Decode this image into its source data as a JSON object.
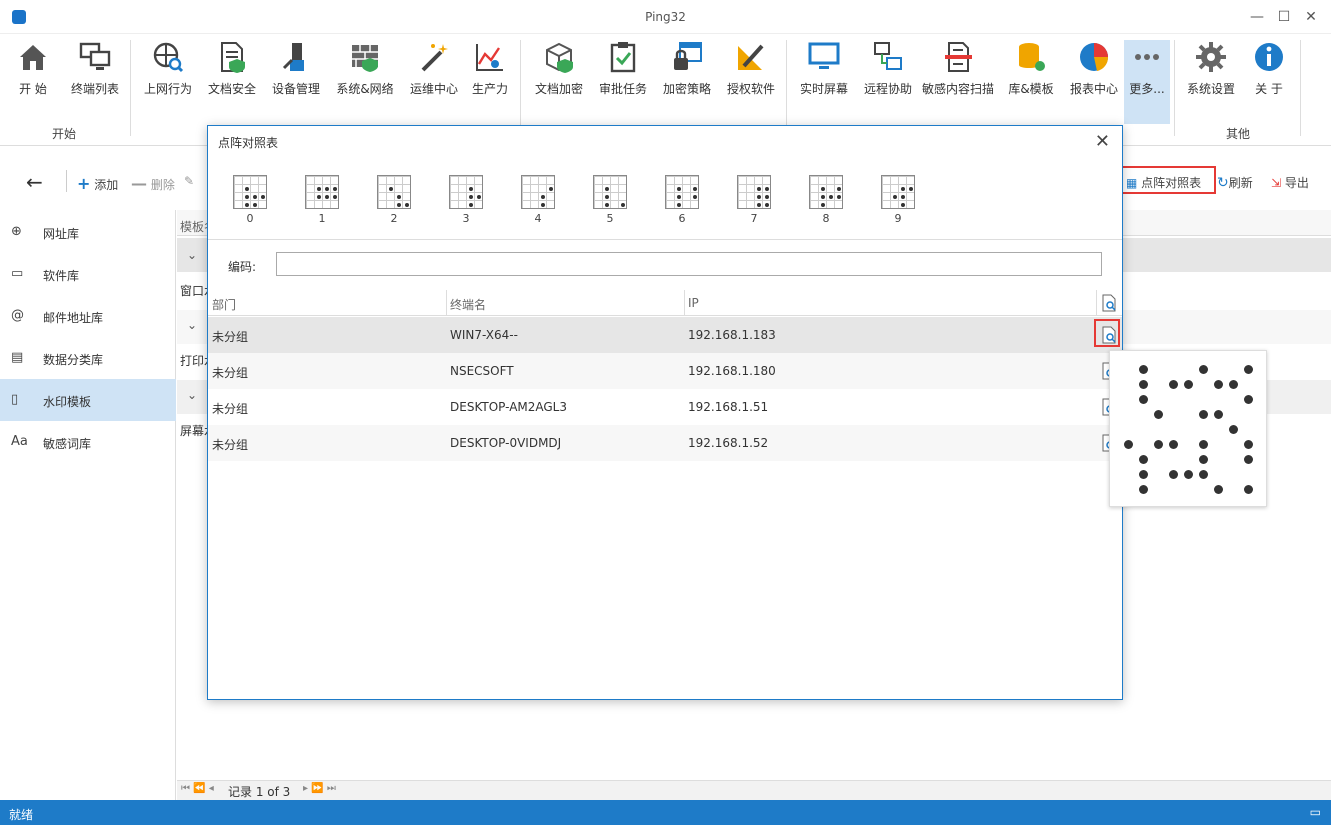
{
  "window": {
    "title": "Ping32"
  },
  "ribbon": {
    "buttons": [
      {
        "label": "开 始",
        "icon": "home-icon"
      },
      {
        "label": "终端列表",
        "icon": "monitors-icon"
      },
      {
        "label": "上网行为",
        "icon": "globe-search-icon"
      },
      {
        "label": "文档安全",
        "icon": "document-shield-icon"
      },
      {
        "label": "设备管理",
        "icon": "usb-tools-icon"
      },
      {
        "label": "系统&网络",
        "icon": "firewall-icon"
      },
      {
        "label": "运维中心",
        "icon": "magic-wand-icon"
      },
      {
        "label": "生产力",
        "icon": "productivity-chart-icon"
      },
      {
        "label": "文档加密",
        "icon": "box-shield-icon"
      },
      {
        "label": "审批任务",
        "icon": "clipboard-check-icon"
      },
      {
        "label": "加密策略",
        "icon": "lock-window-icon"
      },
      {
        "label": "授权软件",
        "icon": "ruler-pencil-icon"
      },
      {
        "label": "实时屏幕",
        "icon": "monitor-icon"
      },
      {
        "label": "远程协助",
        "icon": "remote-network-icon"
      },
      {
        "label": "敏感内容扫描",
        "icon": "document-scan-icon"
      },
      {
        "label": "库&模板",
        "icon": "database-gear-icon"
      },
      {
        "label": "报表中心",
        "icon": "pie-chart-icon"
      },
      {
        "label": "更多...",
        "icon": "more-dots-icon"
      },
      {
        "label": "系统设置",
        "icon": "gear-icon"
      },
      {
        "label": "关 于",
        "icon": "info-icon"
      }
    ],
    "groups": {
      "start": "开始",
      "other": "其他"
    }
  },
  "toolbar": {
    "add": "添加",
    "delete": "删除",
    "dot_matrix": "点阵对照表",
    "refresh": "刷新",
    "export": "导出"
  },
  "sidebar": {
    "items": [
      {
        "label": "网址库",
        "icon": "globe-icon"
      },
      {
        "label": "软件库",
        "icon": "window-icon"
      },
      {
        "label": "邮件地址库",
        "icon": "at-sign-icon"
      },
      {
        "label": "数据分类库",
        "icon": "data-category-icon"
      },
      {
        "label": "水印模板",
        "icon": "watermark-icon"
      },
      {
        "label": "敏感词库",
        "icon": "font-aa-icon"
      }
    ]
  },
  "main": {
    "header": "模板名",
    "rows": [
      "窗口水",
      "打印水",
      "屏幕水"
    ]
  },
  "pager": {
    "text": "记录 1 of 3"
  },
  "status": {
    "text": "就绪"
  },
  "dialog": {
    "title": "点阵对照表",
    "digits": [
      "0",
      "1",
      "2",
      "3",
      "4",
      "5",
      "6",
      "7",
      "8",
      "9"
    ],
    "code_label": "编码:",
    "code_value": "",
    "columns": {
      "dept": "部门",
      "name": "终端名",
      "ip": "IP"
    },
    "rows": [
      {
        "dept": "未分组",
        "name": "WIN7-X64--",
        "ip": "192.168.1.183"
      },
      {
        "dept": "未分组",
        "name": "NSECSOFT",
        "ip": "192.168.1.180"
      },
      {
        "dept": "未分组",
        "name": "DESKTOP-AM2AGL3",
        "ip": "192.168.1.51"
      },
      {
        "dept": "未分组",
        "name": "DESKTOP-0VIDMDJ",
        "ip": "192.168.1.52"
      }
    ]
  }
}
